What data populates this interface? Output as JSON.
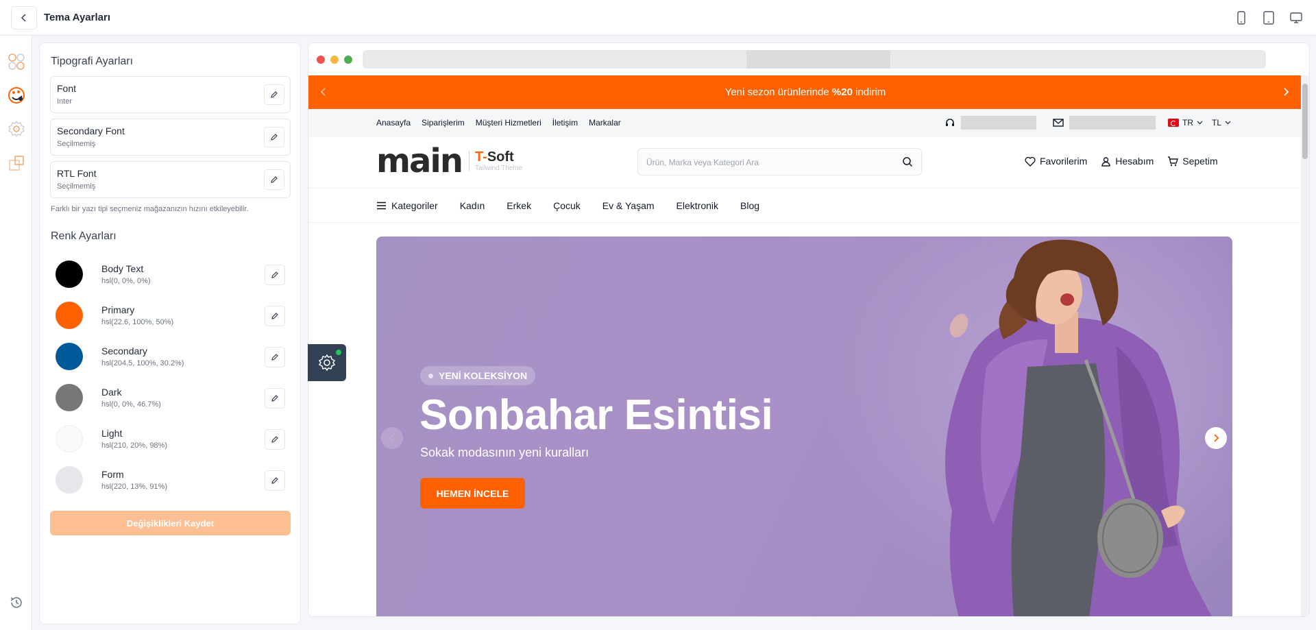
{
  "app": {
    "title": "Tema Ayarları"
  },
  "typography": {
    "title": "Tipografi Ayarları",
    "fonts": [
      {
        "label": "Font",
        "value": "Inter"
      },
      {
        "label": "Secondary Font",
        "value": "Seçilmemiş"
      },
      {
        "label": "RTL Font",
        "value": "Seçilmemiş"
      }
    ],
    "hint": "Farklı bir yazı tipi seçmeniz mağazanızın hızını etkileyebilir."
  },
  "colors": {
    "title": "Renk Ayarları",
    "items": [
      {
        "name": "Body Text",
        "value": "hsl(0, 0%, 0%)",
        "swatch": "#000000"
      },
      {
        "name": "Primary",
        "value": "hsl(22.6, 100%, 50%)",
        "swatch": "#ff6000"
      },
      {
        "name": "Secondary",
        "value": "hsl(204.5, 100%, 30.2%)",
        "swatch": "#005a9a"
      },
      {
        "name": "Dark",
        "value": "hsl(0, 0%, 46.7%)",
        "swatch": "#777777"
      },
      {
        "name": "Light",
        "value": "hsl(210, 20%, 98%)",
        "swatch": "#f9fafb"
      },
      {
        "name": "Form",
        "value": "hsl(220, 13%, 91%)",
        "swatch": "#e5e7eb"
      }
    ],
    "save_label": "Değişiklikleri Kaydet"
  },
  "preview": {
    "announcement": {
      "text_before": "Yeni sezon ürünlerinde ",
      "highlight": "%20",
      "text_after": " indirim"
    },
    "top_links": [
      "Anasayfa",
      "Siparişlerim",
      "Müşteri Hizmetleri",
      "İletişim",
      "Markalar"
    ],
    "language": "TR",
    "currency": "TL",
    "logo": {
      "main": "main",
      "brand_t": "T-",
      "brand_soft": "Soft",
      "sub": "Tailwind Theme"
    },
    "search_placeholder": "Ürün, Marka veya Kategori Ara",
    "header_links": {
      "favorites": "Favorilerim",
      "account": "Hesabım",
      "cart": "Sepetim"
    },
    "categories": [
      "Kategoriler",
      "Kadın",
      "Erkek",
      "Çocuk",
      "Ev & Yaşam",
      "Elektronik",
      "Blog"
    ],
    "hero": {
      "badge": "YENİ KOLEKSİYON",
      "title": "Sonbahar Esintisi",
      "subtitle": "Sokak modasının yeni kuralları",
      "cta": "HEMEN İNCELE"
    }
  },
  "theme": {
    "accent": "#ff6100",
    "accent_light": "#fdbf91",
    "dark_tab": "#334155",
    "online": "#22c55e"
  }
}
